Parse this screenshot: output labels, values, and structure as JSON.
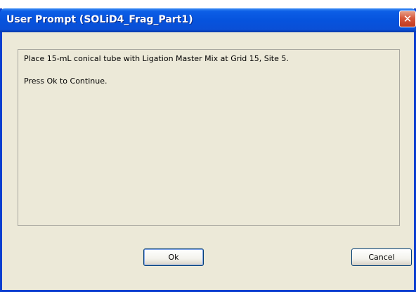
{
  "window": {
    "title": "User Prompt (SOLiD4_Frag_Part1)",
    "close_glyph": "✕"
  },
  "message": {
    "line1": "Place 15-mL conical tube with Ligation Master Mix at Grid 15, Site 5.",
    "line2": "Press Ok to Continue."
  },
  "buttons": {
    "ok_label": "Ok",
    "cancel_label": "Cancel"
  },
  "colors": {
    "titlebar": "#0653dd",
    "dialog_face": "#ece9d8",
    "close_button": "#d8583c"
  }
}
